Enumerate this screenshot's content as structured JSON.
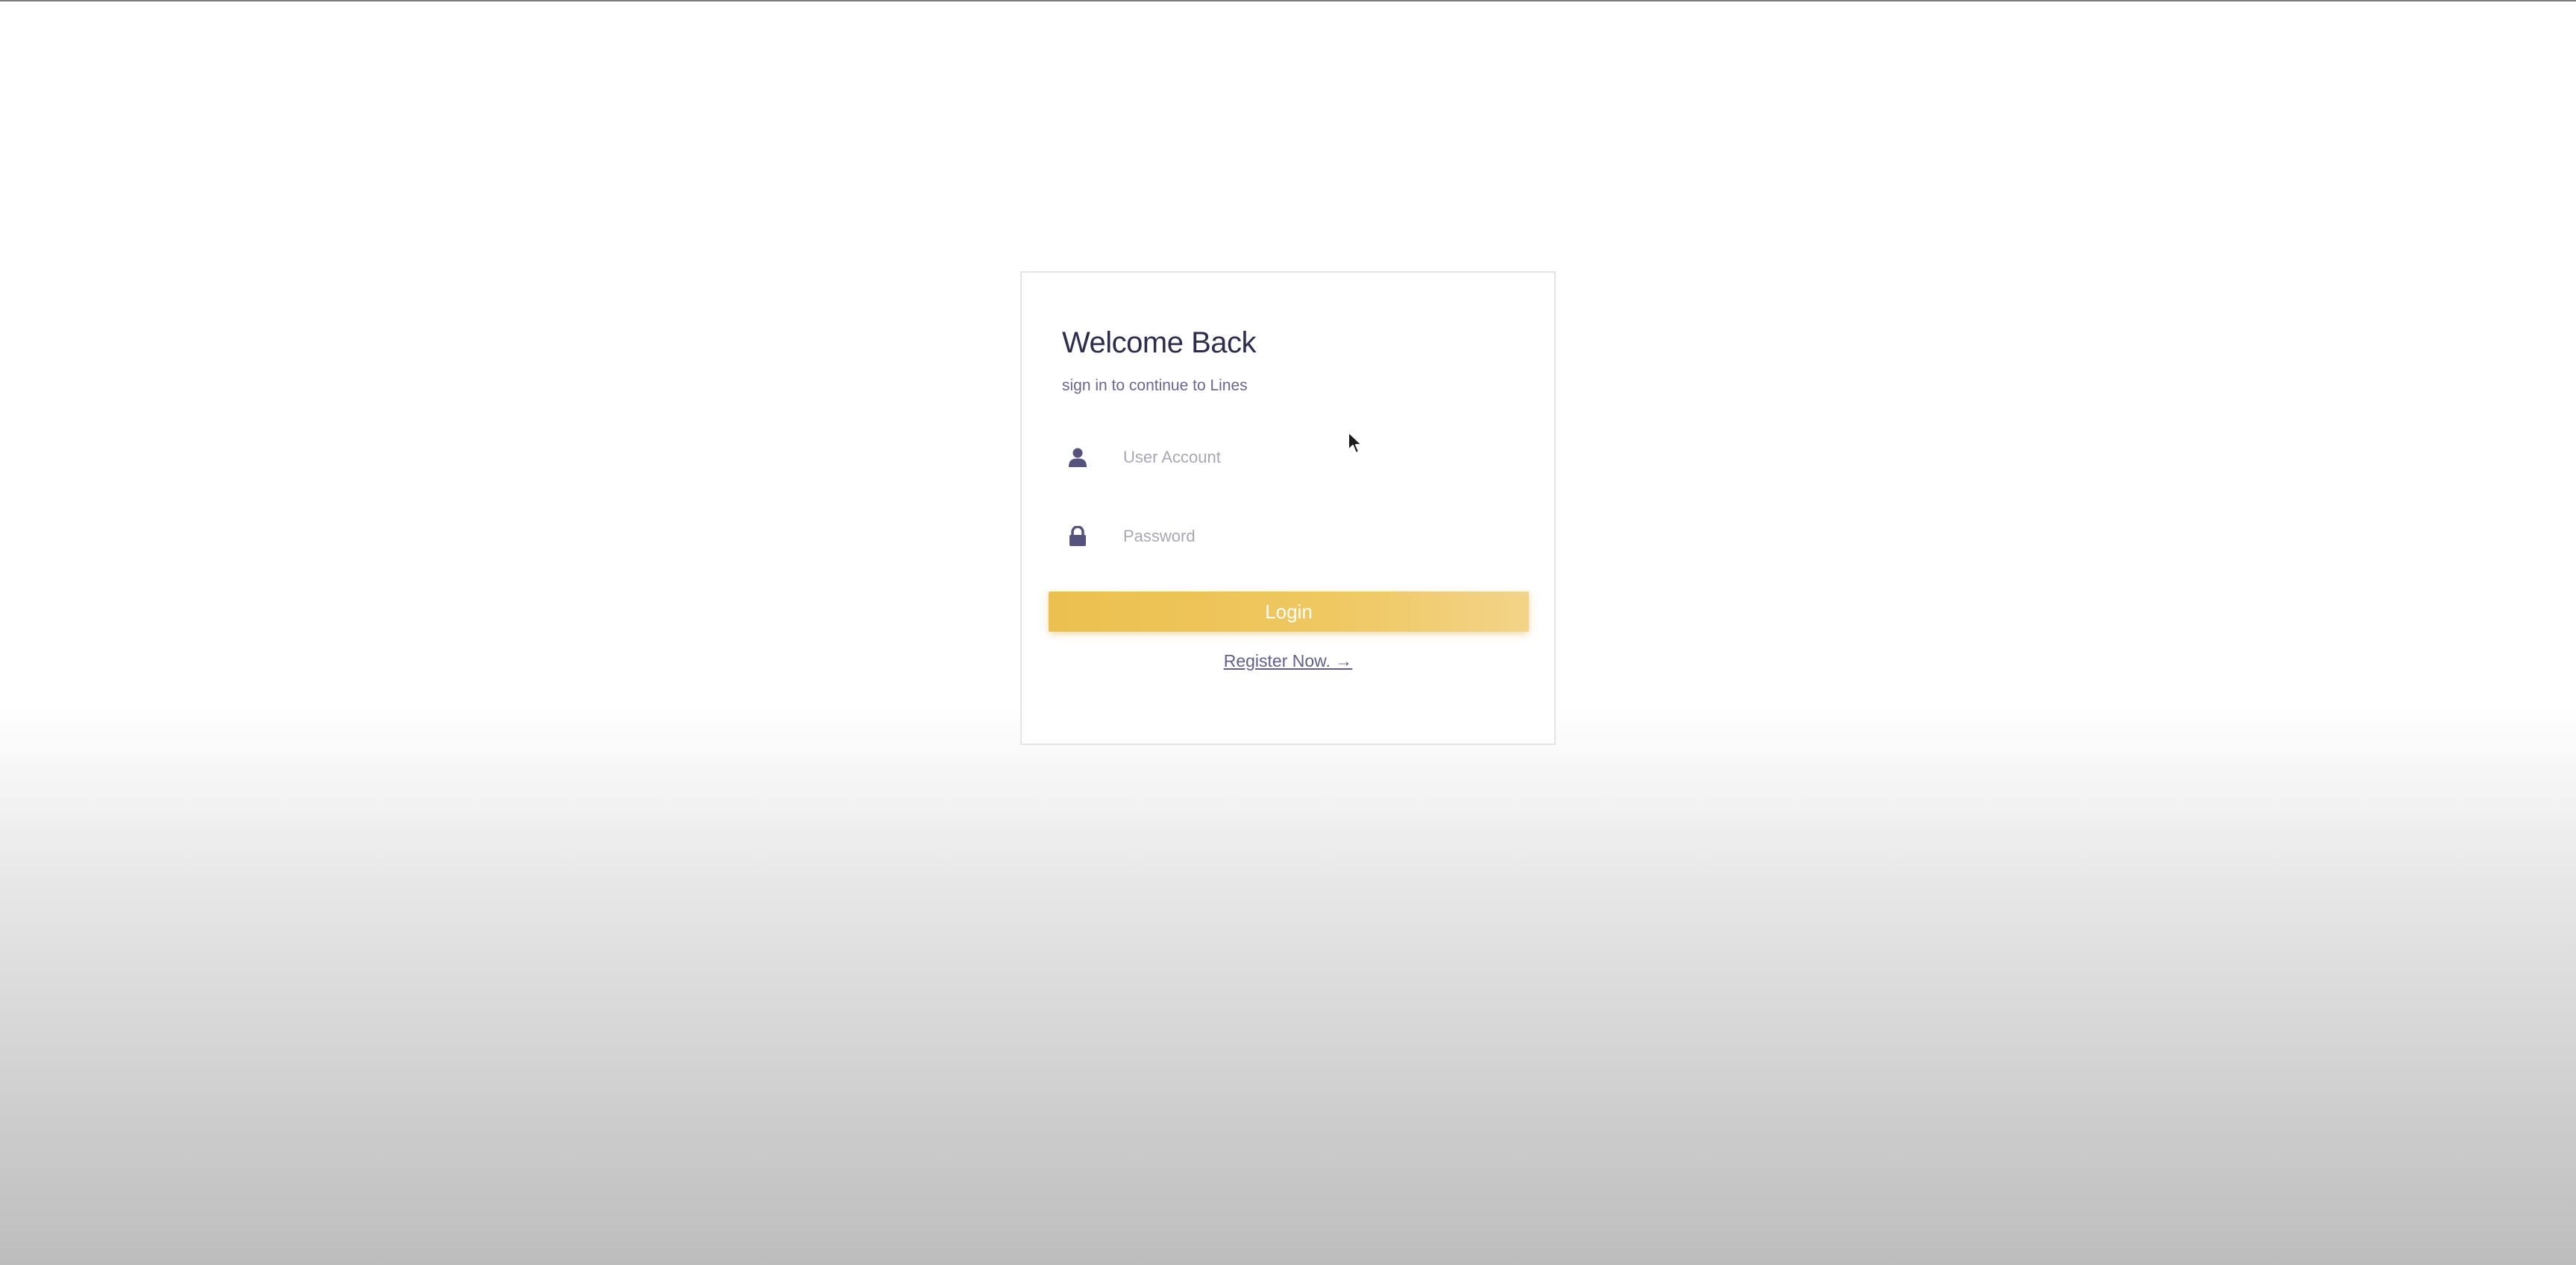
{
  "login": {
    "title": "Welcome Back",
    "subtitle": "sign in to continue to Lines",
    "username": {
      "placeholder": "User Account",
      "value": "",
      "icon": "user-icon"
    },
    "password": {
      "placeholder": "Password",
      "value": "",
      "icon": "lock-icon"
    },
    "login_button_label": "Login",
    "register_link_label": "Register Now. →"
  },
  "colors": {
    "accent_gold": "#ecc04f",
    "heading": "#2e2d4d",
    "link": "#625f8c",
    "icon": "#55527e"
  }
}
